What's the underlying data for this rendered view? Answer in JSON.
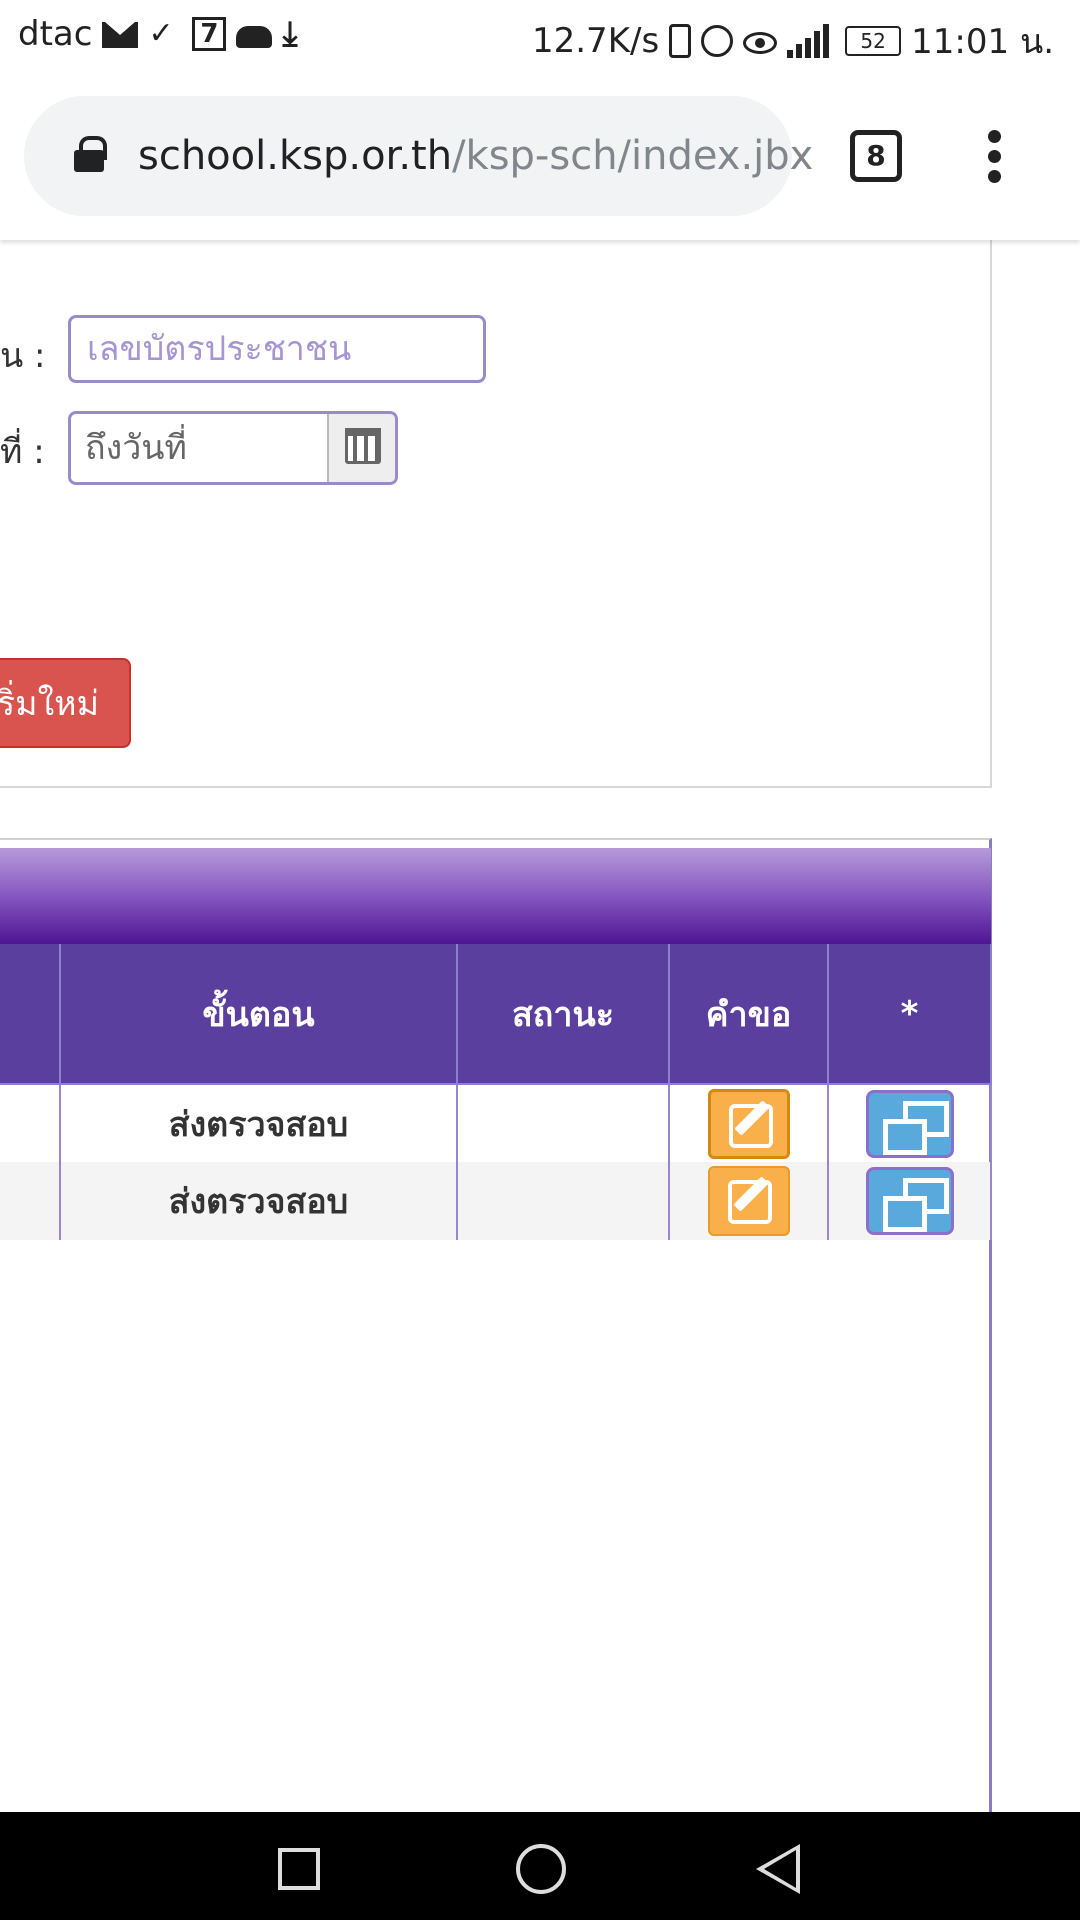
{
  "status_bar": {
    "carrier": "dtac",
    "seven_eleven_glyph": "7",
    "net_speed": "12.7K/s",
    "battery": "52",
    "time": "11:01 น.",
    "icons": [
      "mail-icon",
      "check-icon",
      "seven-eleven-icon",
      "cloud-icon",
      "download-icon",
      "vibrate-icon",
      "alarm-icon",
      "eye-icon",
      "signal-icon",
      "battery-icon"
    ]
  },
  "browser": {
    "url_host": "school.ksp.or.th",
    "url_path": "/ksp-sch/index.jbx",
    "tab_count": "8"
  },
  "search_form": {
    "id_label": "น :",
    "id_placeholder": "เลขบัตรประชาชน",
    "date_label": "ที่ :",
    "date_placeholder": "ถึงวันที่",
    "reset_label": "ริ่มใหม่"
  },
  "results_table": {
    "columns": [
      "ขั้นตอน",
      "สถานะ",
      "คำขอ",
      "*"
    ],
    "rows": [
      {
        "step": "ส่งตรวจสอบ",
        "status": ""
      },
      {
        "step": "ส่งตรวจสอบ",
        "status": ""
      }
    ]
  },
  "colors": {
    "accent_purple": "#5b3f9e",
    "reset_red": "#d9534f",
    "edit_orange": "#f9b04a",
    "copy_blue": "#5aa9dc"
  }
}
